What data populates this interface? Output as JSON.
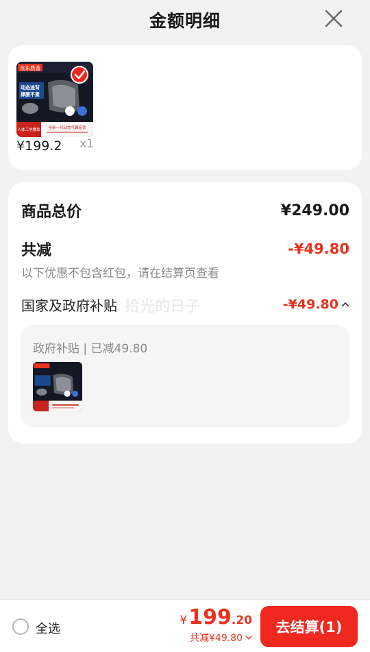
{
  "header": {
    "title": "金额明细"
  },
  "product": {
    "badge": "京东质造",
    "slogan_line1": "动态追背",
    "slogan_line2": "撑腰不累",
    "banner_left": "人体工学腰靠",
    "banner_right": "全新一代动态气囊追背",
    "price": "¥199.2",
    "qty": "x1"
  },
  "detail": {
    "total_label": "商品总价",
    "total_value": "¥249.00",
    "discount_label": "共减",
    "discount_value": "-¥49.80",
    "note": "以下优惠不包含红包，请在结算页查看",
    "subsidy_label": "国家及政府补贴",
    "subsidy_value": "-¥49.80",
    "watermark": "拾光的日子",
    "sub_box_title": "政府补贴 | 已减49.80"
  },
  "bottom": {
    "select_all": "全选",
    "pay_yen": "¥",
    "pay_int": "199",
    "pay_dec": ".20",
    "saved": "共减¥49.80",
    "checkout": "去结算(1)"
  },
  "colors": {
    "accent_red": "#e8341f",
    "button_red": "#f0281f"
  }
}
